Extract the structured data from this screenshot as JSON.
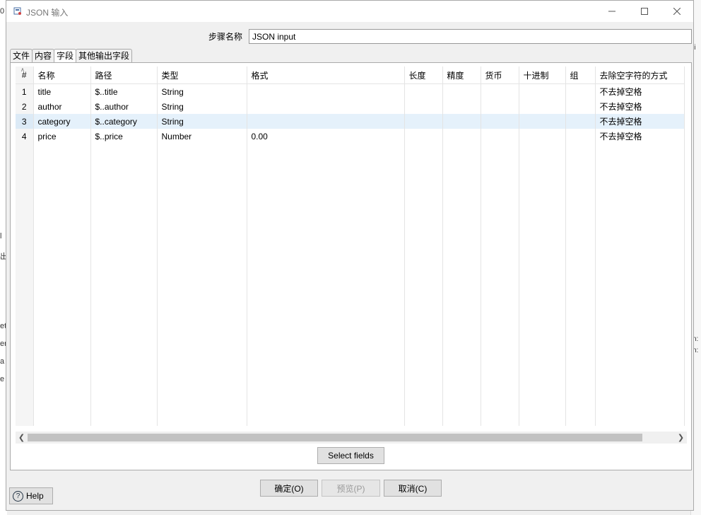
{
  "window": {
    "title": "JSON 输入"
  },
  "step": {
    "label": "步骤名称",
    "value": "JSON input"
  },
  "tabs": [
    {
      "label": "文件"
    },
    {
      "label": "内容"
    },
    {
      "label": "字段",
      "active": true
    },
    {
      "label": "其他输出字段"
    }
  ],
  "grid": {
    "columns": [
      "#",
      "名称",
      "路径",
      "类型",
      "格式",
      "长度",
      "精度",
      "货币",
      "十进制",
      "组",
      "去除空字符的方式"
    ],
    "rows": [
      [
        "1",
        "title",
        "$..title",
        "String",
        "",
        "",
        "",
        "",
        "",
        "",
        "不去掉空格"
      ],
      [
        "2",
        "author",
        "$..author",
        "String",
        "",
        "",
        "",
        "",
        "",
        "",
        "不去掉空格"
      ],
      [
        "3",
        "category",
        "$..category",
        "String",
        "",
        "",
        "",
        "",
        "",
        "",
        "不去掉空格"
      ],
      [
        "4",
        "price",
        "$..price",
        "Number",
        "0.00",
        "",
        "",
        "",
        "",
        "",
        "不去掉空格"
      ]
    ],
    "selected_row": 3
  },
  "buttons": {
    "select_fields": "Select fields",
    "ok": "确定(O)",
    "preview": "预览(P)",
    "cancel": "取消(C)",
    "help": "Help"
  }
}
